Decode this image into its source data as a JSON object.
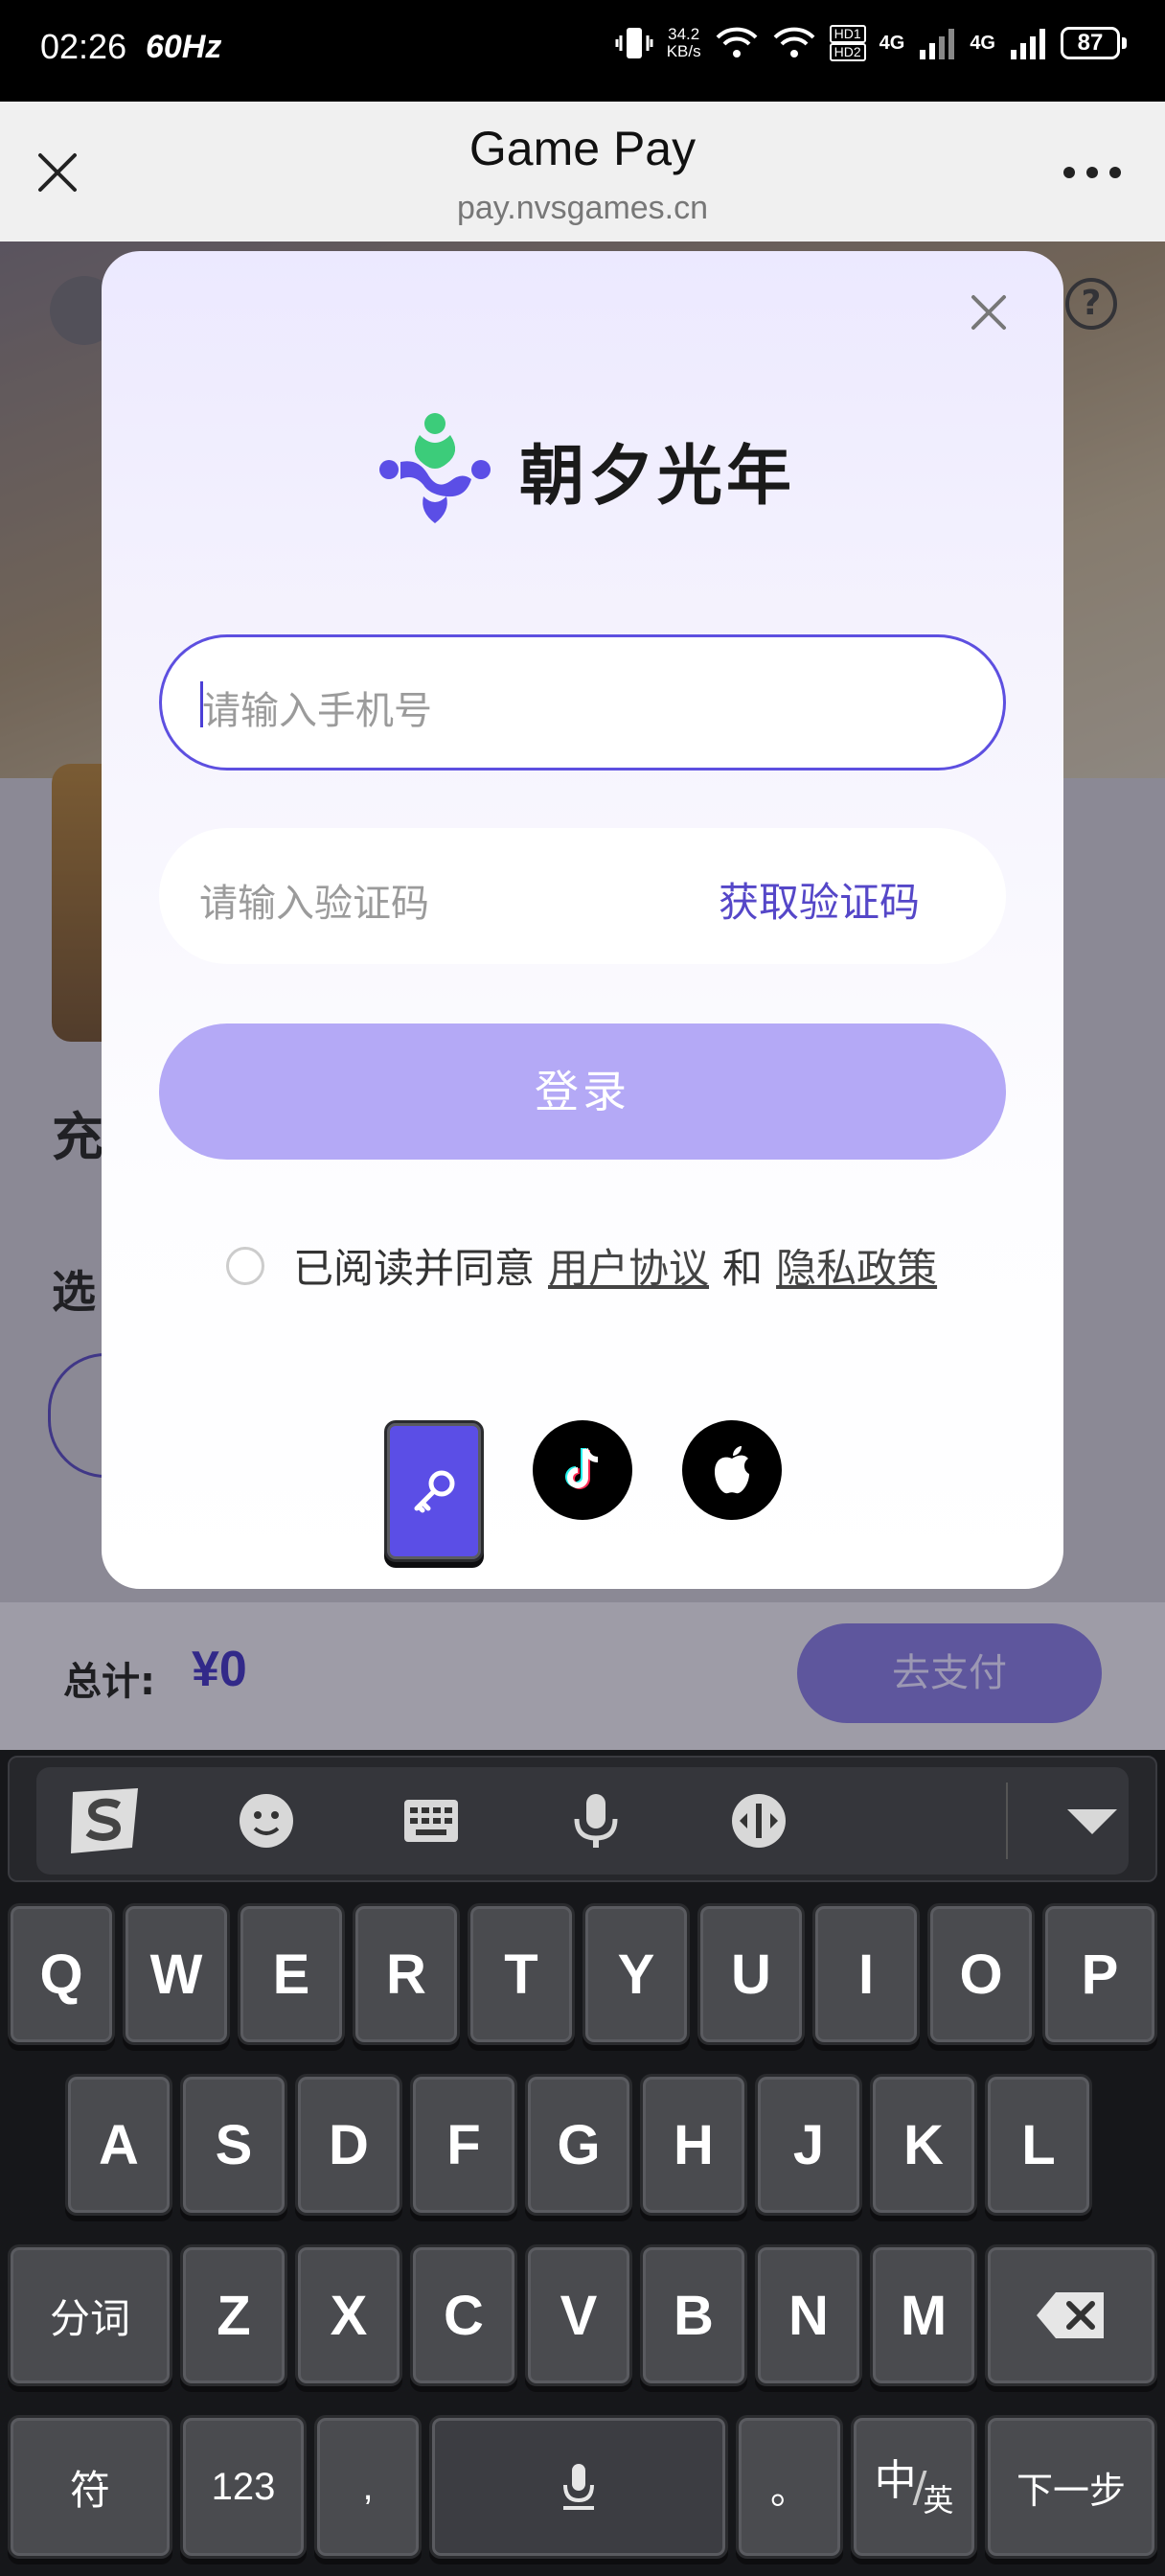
{
  "status_bar": {
    "time": "02:26",
    "refresh": "60Hz",
    "speed_value": "34.2",
    "speed_unit": "KB/s",
    "hd1": "HD1",
    "hd2": "HD2",
    "net1": "4G",
    "net2": "4G",
    "battery": "87"
  },
  "browser": {
    "title": "Game Pay",
    "url": "pay.nvsgames.cn"
  },
  "background_page": {
    "heading_partial": "充",
    "select_partial": "选",
    "help_glyph": "?"
  },
  "pay_bar": {
    "total_label": "总计:",
    "total_value": "¥0",
    "pay_button": "去支付"
  },
  "login_modal": {
    "brand": "朝夕光年",
    "phone_placeholder": "请输入手机号",
    "code_placeholder": "请输入验证码",
    "get_code": "获取验证码",
    "login_button": "登录",
    "agree_prefix": "已阅读并同意",
    "user_agreement": "用户协议",
    "and": "和",
    "privacy_policy": "隐私政策",
    "social_icons": [
      "key-icon",
      "tiktok-icon",
      "apple-icon"
    ]
  },
  "keyboard": {
    "toolbar_icons": [
      "sogou-logo-icon",
      "emoji-icon",
      "keyboard-icon",
      "microphone-icon",
      "cursor-icon",
      "collapse-icon"
    ],
    "row1": [
      "Q",
      "W",
      "E",
      "R",
      "T",
      "Y",
      "U",
      "I",
      "O",
      "P"
    ],
    "row2": [
      "A",
      "S",
      "D",
      "F",
      "G",
      "H",
      "J",
      "K",
      "L"
    ],
    "row3_left": "分词",
    "row3": [
      "Z",
      "X",
      "C",
      "V",
      "B",
      "N",
      "M"
    ],
    "row4": {
      "symbols": "符",
      "numbers": "123",
      "comma": ",",
      "period": "。",
      "lang_main": "中",
      "lang_sub": "英",
      "next": "下一步"
    }
  },
  "colors": {
    "accent": "#5b4ee6",
    "login_button": "#b4a9f6",
    "link": "#5547c8"
  }
}
